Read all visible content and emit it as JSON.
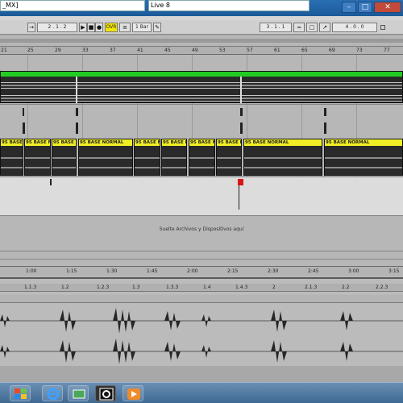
{
  "window": {
    "left_title": "_MX]",
    "right_title": "Live 8",
    "controls": [
      "–",
      "□",
      "✕"
    ]
  },
  "transport": {
    "position": "2 . 1 . 2",
    "ovr_label": "OVR",
    "quantize": "1 Bar",
    "loop_start": "3 . 1 . 1",
    "loop_length": "4 . 0 . 0"
  },
  "bar_ruler": {
    "labels": [
      "21",
      "25",
      "29",
      "33",
      "37",
      "41",
      "45",
      "49",
      "53",
      "57",
      "61",
      "65",
      "69",
      "73",
      "77"
    ]
  },
  "clips": {
    "label": "95 BASE NORMAL",
    "short_label": "95 BASE N",
    "count": 10
  },
  "drop_zone": {
    "text": "Suelte Archivos y Dispositivos aquí"
  },
  "time_ruler": {
    "labels": [
      "1:00",
      "1:15",
      "1:30",
      "1:45",
      "2:00",
      "2:15",
      "2:30",
      "2:45",
      "3:00",
      "3:15"
    ]
  },
  "detail_ruler": {
    "labels": [
      "1.1.3",
      "1.2",
      "1.2.3",
      "1.3",
      "1.3.3",
      "1.4",
      "1.4.3",
      "2",
      "2.1.3",
      "2.2",
      "2.2.3"
    ]
  },
  "taskbar": {
    "icons": [
      "windows-logo",
      "ie-icon",
      "network-icon",
      "ableton-icon",
      "media-player-icon"
    ]
  },
  "colors": {
    "clip_yellow": "#f0ef25",
    "green_bar": "#22cc22",
    "red_marker": "#d91616",
    "title_blue": "#1b5a99"
  }
}
